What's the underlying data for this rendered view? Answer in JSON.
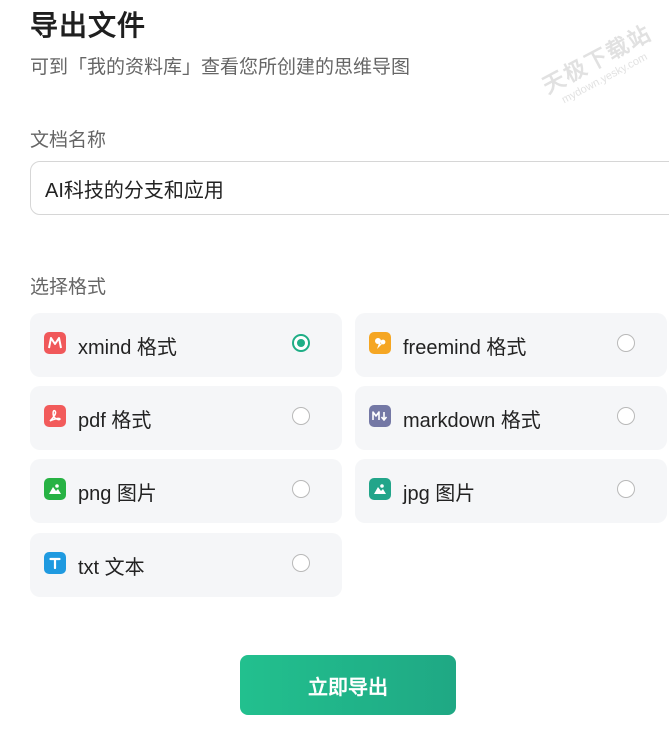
{
  "header": {
    "title": "导出文件",
    "subtitle": "可到「我的资料库」查看您所创建的思维导图"
  },
  "name_section": {
    "label": "文档名称",
    "value": "AI科技的分支和应用"
  },
  "format_section": {
    "label": "选择格式",
    "options": [
      {
        "label": "xmind 格式",
        "icon": "xmind-icon",
        "color": "#f0585a",
        "selected": true
      },
      {
        "label": "freemind 格式",
        "icon": "freemind-icon",
        "color": "#f5a623",
        "selected": false
      },
      {
        "label": "pdf 格式",
        "icon": "pdf-icon",
        "color": "#f25b5b",
        "selected": false
      },
      {
        "label": "markdown 格式",
        "icon": "markdown-icon",
        "color": "#7478a5",
        "selected": false
      },
      {
        "label": "png 图片",
        "icon": "png-image-icon",
        "color": "#27b244",
        "selected": false
      },
      {
        "label": "jpg 图片",
        "icon": "jpg-image-icon",
        "color": "#22a58a",
        "selected": false
      },
      {
        "label": "txt 文本",
        "icon": "txt-icon",
        "color": "#1f9ae0",
        "selected": false
      }
    ]
  },
  "actions": {
    "export_label": "立即导出"
  },
  "watermark": {
    "text": "天极下载站",
    "subtext": "mydown.yesky.com"
  },
  "colors": {
    "accent": "#1fae86",
    "option_bg": "#f5f6f8"
  }
}
